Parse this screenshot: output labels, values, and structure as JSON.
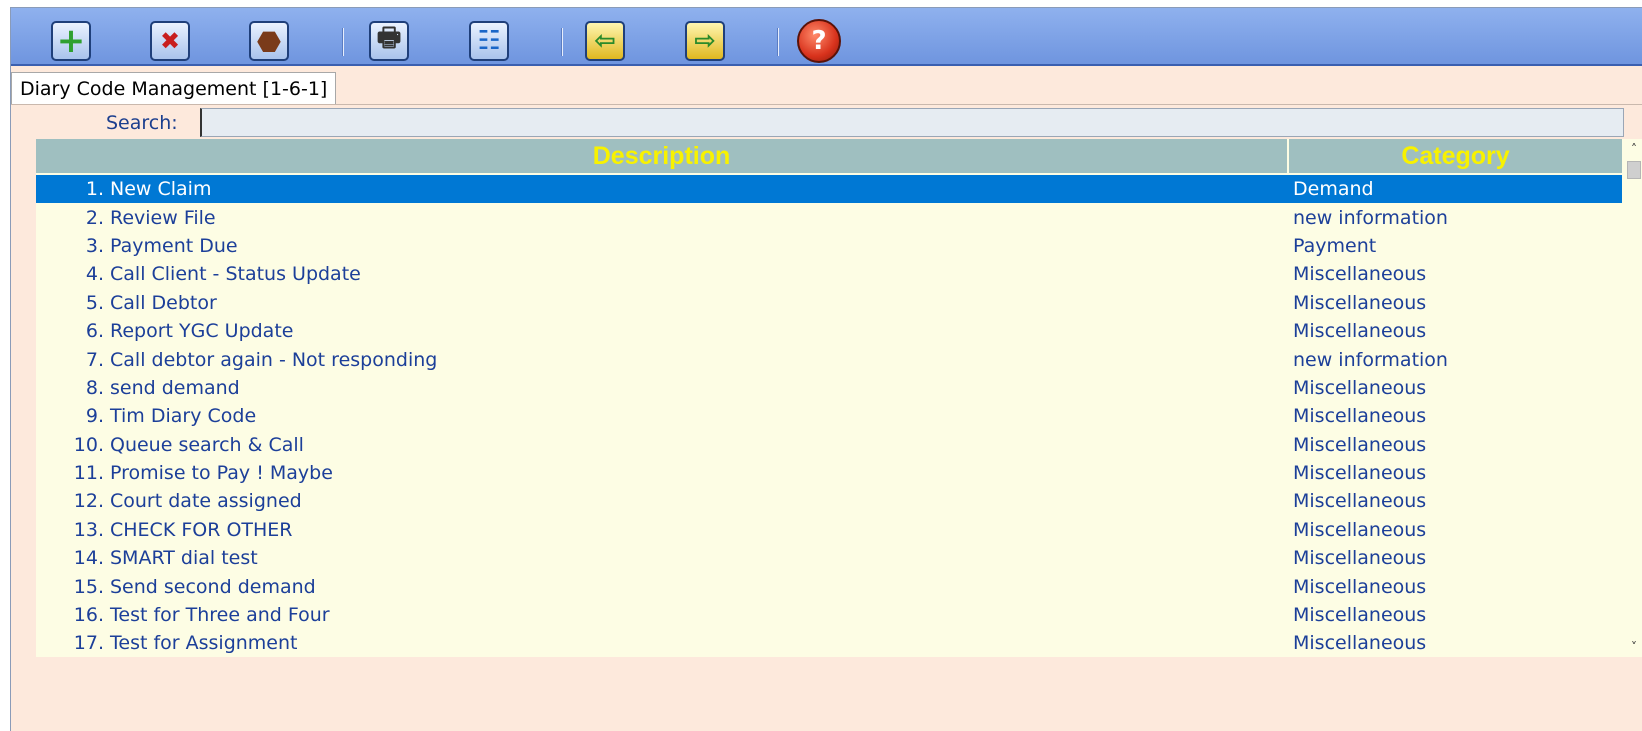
{
  "toolbar": {
    "buttons": [
      {
        "name": "add-button",
        "icon": "plus-icon",
        "glyph": "+",
        "color": "#2fa02f"
      },
      {
        "name": "delete-button",
        "icon": "x-icon",
        "glyph": "✖",
        "color": "#c81e1e"
      },
      {
        "name": "edit-button",
        "icon": "hexagon-icon",
        "glyph": "⬣",
        "color": "#7a3b1a"
      },
      {
        "name": "print-button",
        "icon": "printer-icon",
        "glyph": "🖶",
        "color": "#333333"
      },
      {
        "name": "tree-button",
        "icon": "tree-view-icon",
        "glyph": "☷",
        "color": "#1a66c8"
      },
      {
        "name": "import-button",
        "icon": "database-import-icon",
        "glyph": "⇦",
        "color": "#2a8a2a"
      },
      {
        "name": "export-button",
        "icon": "database-export-icon",
        "glyph": "⇨",
        "color": "#2a8a2a"
      },
      {
        "name": "help-button",
        "icon": "help-icon",
        "glyph": "?",
        "color": "#d8321c"
      }
    ]
  },
  "tab": {
    "label": "Diary Code Management [1-6-1]"
  },
  "search": {
    "label": "Search:",
    "value": "",
    "placeholder": ""
  },
  "table": {
    "columns": {
      "description": "Description",
      "category": "Category"
    },
    "selected_index": 0,
    "rows": [
      {
        "num": "1.",
        "description": "New Claim",
        "category": "Demand"
      },
      {
        "num": "2.",
        "description": "Review File",
        "category": "new information"
      },
      {
        "num": "3.",
        "description": "Payment Due",
        "category": "Payment"
      },
      {
        "num": "4.",
        "description": "Call Client - Status Update",
        "category": "Miscellaneous"
      },
      {
        "num": "5.",
        "description": "Call Debtor",
        "category": "Miscellaneous"
      },
      {
        "num": "6.",
        "description": "Report YGC Update",
        "category": "Miscellaneous"
      },
      {
        "num": "7.",
        "description": "Call debtor again - Not responding",
        "category": "new information"
      },
      {
        "num": "8.",
        "description": "send demand",
        "category": "Miscellaneous"
      },
      {
        "num": "9.",
        "description": "Tim Diary Code",
        "category": "Miscellaneous"
      },
      {
        "num": "10.",
        "description": "Queue search & Call",
        "category": "Miscellaneous"
      },
      {
        "num": "11.",
        "description": "Promise to Pay ! Maybe",
        "category": "Miscellaneous"
      },
      {
        "num": "12.",
        "description": "Court date assigned",
        "category": "Miscellaneous"
      },
      {
        "num": "13.",
        "description": "CHECK FOR OTHER",
        "category": "Miscellaneous"
      },
      {
        "num": "14.",
        "description": "SMART dial test",
        "category": "Miscellaneous"
      },
      {
        "num": "15.",
        "description": "Send second demand",
        "category": "Miscellaneous"
      },
      {
        "num": "16.",
        "description": "Test for Three and Four",
        "category": "Miscellaneous"
      },
      {
        "num": "17.",
        "description": "Test for Assignment",
        "category": "Miscellaneous"
      }
    ]
  },
  "colors": {
    "header_bg": "#9fbfc0",
    "header_text": "#f8f200",
    "row_text": "#1c3f99",
    "selected_bg": "#0078d4",
    "grid_bg": "#fdfde4",
    "window_bg": "#fde9dc"
  }
}
